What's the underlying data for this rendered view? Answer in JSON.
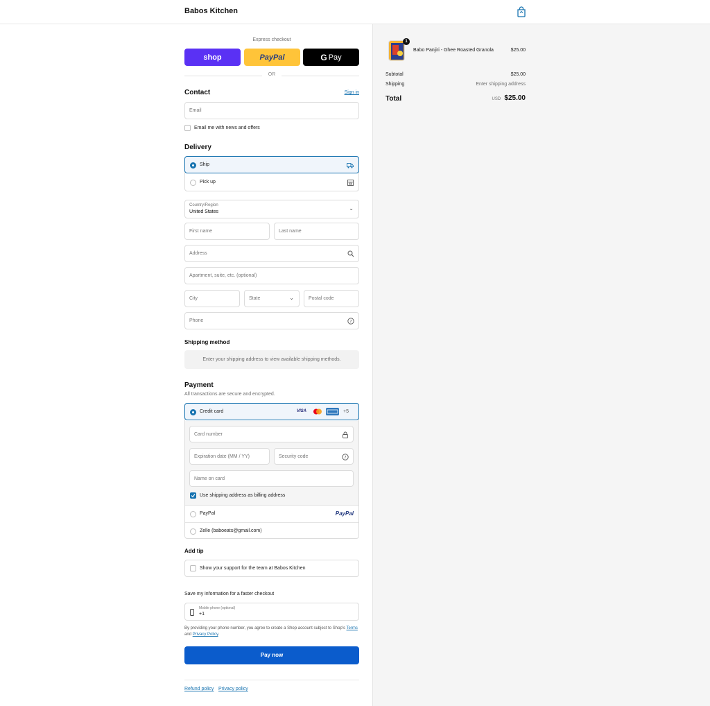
{
  "header": {
    "store_name": "Babos Kitchen"
  },
  "express": {
    "label": "Express checkout",
    "shop_label": "shop",
    "paypal_label": "PayPal",
    "gpay_label": "Pay",
    "or_label": "OR"
  },
  "contact": {
    "title": "Contact",
    "sign_in": "Sign in",
    "email_placeholder": "Email",
    "news_label": "Email me with news and offers"
  },
  "delivery": {
    "title": "Delivery",
    "ship_label": "Ship",
    "pickup_label": "Pick up",
    "country_label": "Country/Region",
    "country_value": "United States",
    "first_name": "First name",
    "last_name": "Last name",
    "address": "Address",
    "apartment": "Apartment, suite, etc. (optional)",
    "city": "City",
    "state": "State",
    "postal": "Postal code",
    "phone": "Phone"
  },
  "shipping_method": {
    "title": "Shipping method",
    "info": "Enter your shipping address to view available shipping methods."
  },
  "payment": {
    "title": "Payment",
    "subtitle": "All transactions are secure and encrypted.",
    "credit_card_label": "Credit card",
    "more_cards": "+5",
    "card_number": "Card number",
    "expiration": "Expiration date (MM / YY)",
    "security_code": "Security code",
    "name_on_card": "Name on card",
    "billing_same": "Use shipping address as billing address",
    "paypal_label": "PayPal",
    "paypal_logo": "PayPal",
    "zelle_label": "Zelle (baboeats@gmail.com)",
    "visa": "VISA"
  },
  "tip": {
    "title": "Add tip",
    "label": "Show your support for the team at Babos Kitchen"
  },
  "save_info": {
    "title": "Save my information for a faster checkout",
    "phone_label": "Mobile phone (optional)",
    "phone_prefix": "+1",
    "disclaimer_1": "By providing your phone number, you agree to create a Shop account subject to Shop's",
    "terms": "Terms",
    "disclaimer_and": "and",
    "privacy": "Privacy Policy",
    "disclaimer_end": "."
  },
  "pay_now_label": "Pay now",
  "footer": {
    "refund_policy": "Refund policy",
    "privacy_policy": "Privacy policy"
  },
  "summary": {
    "item_name": "Babo Panjiri - Ghee Roasted Granola",
    "item_price": "$25.00",
    "item_qty": "1",
    "subtotal_label": "Subtotal",
    "subtotal_value": "$25.00",
    "shipping_label": "Shipping",
    "shipping_value": "Enter shipping address",
    "total_label": "Total",
    "currency": "USD",
    "total_value": "$25.00"
  },
  "colors": {
    "accent": "#1773b0",
    "pay_button": "#0b5ccc",
    "shop_purple": "#5a31f4",
    "paypal_yellow": "#ffc439"
  }
}
